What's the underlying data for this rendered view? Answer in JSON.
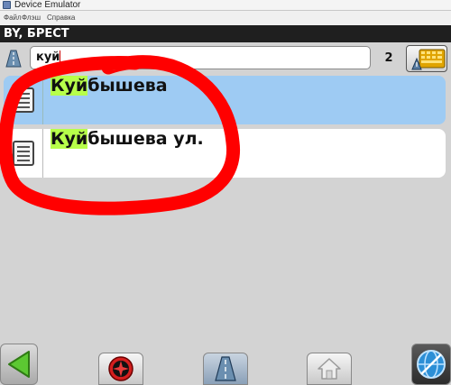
{
  "window": {
    "title": "Device Emulator"
  },
  "menu": {
    "items": [
      "Файл",
      "Флэш",
      "Справка"
    ]
  },
  "header": {
    "region": "BY, БРЕСТ"
  },
  "search": {
    "value": "куй",
    "result_count": "2"
  },
  "results": [
    {
      "match": "Куй",
      "rest": "бышева",
      "selected": true
    },
    {
      "match": "Куй",
      "rest": "бышева ул.",
      "selected": false
    }
  ],
  "toolbar": {
    "buttons": [
      "back-arrow-icon",
      "compass-icon",
      "road-icon",
      "home-icon",
      "globe-icon"
    ]
  },
  "colors": {
    "header_bg": "#1f1f1f",
    "selected_row": "#9ecbf3",
    "match_highlight": "#b7ff4a",
    "annotation_red": "#ff0000",
    "back_arrow": "#5cc832"
  }
}
